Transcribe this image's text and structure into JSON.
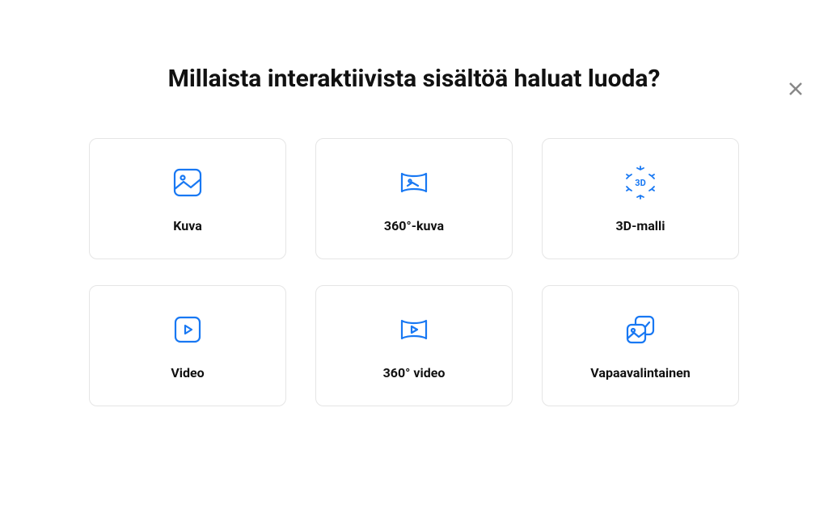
{
  "title": "Millaista interaktiivista sisältöä haluat luoda?",
  "cards": [
    {
      "label": "Kuva"
    },
    {
      "label": "360°-kuva"
    },
    {
      "label": "3D-malli"
    },
    {
      "label": "Video"
    },
    {
      "label": "360° video"
    },
    {
      "label": "Vapaavalintainen"
    }
  ]
}
